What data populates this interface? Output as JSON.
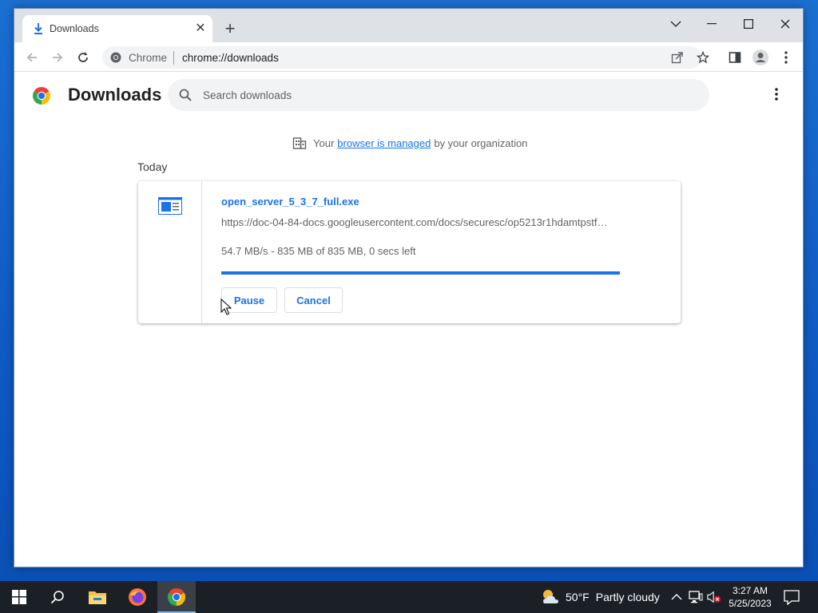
{
  "browser": {
    "tab": {
      "title": "Downloads",
      "close_glyph": "✕"
    },
    "new_tab_glyph": "+",
    "omnibox": {
      "site_label": "Chrome",
      "url": "chrome://downloads"
    }
  },
  "page": {
    "title": "Downloads",
    "search": {
      "placeholder": "Search downloads",
      "value": ""
    },
    "managed_notice": {
      "prefix": "Your",
      "link": "browser is managed",
      "suffix": "by your organization"
    },
    "section": "Today",
    "download": {
      "file_name": "open_server_5_3_7_full.exe",
      "url": "https://doc-04-84-docs.googleusercontent.com/docs/securesc/op5213r1hdamtpstf…",
      "status": "54.7 MB/s - 835 MB of 835 MB, 0 secs left",
      "progress_fraction": 1.0,
      "pause_label": "Pause",
      "cancel_label": "Cancel"
    }
  },
  "taskbar": {
    "weather": {
      "temp": "50°F",
      "condition": "Partly cloudy"
    },
    "clock": {
      "time": "3:27 AM",
      "date": "5/25/2023"
    }
  },
  "colors": {
    "accent": "#1a73e8",
    "desktop": "#0f5bc4",
    "taskbar": "#1b2027"
  },
  "icons": [
    "download-icon",
    "close-icon",
    "plus-icon",
    "chevron-down-icon",
    "minimize-icon",
    "maximize-icon",
    "back-icon",
    "forward-icon",
    "reload-icon",
    "chrome-site-icon",
    "share-icon",
    "star-icon",
    "side-panel-icon",
    "profile-icon",
    "more-vert-icon",
    "chrome-logo-icon",
    "search-icon",
    "building-icon",
    "exe-file-icon",
    "mouse-cursor-icon",
    "windows-start-icon",
    "taskbar-search-icon",
    "file-explorer-icon",
    "firefox-icon",
    "chrome-icon",
    "weather-icon",
    "chevron-up-icon",
    "network-icon",
    "volume-muted-icon",
    "notification-icon"
  ]
}
